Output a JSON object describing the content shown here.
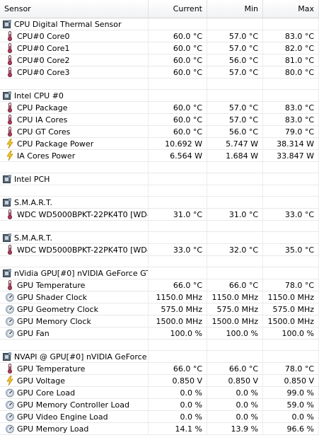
{
  "header": {
    "sensor": "Sensor",
    "current": "Current",
    "min": "Min",
    "max": "Max"
  },
  "rows": [
    {
      "kind": "group",
      "icon": "chip-icon",
      "label": "CPU Digital Thermal Sensor"
    },
    {
      "kind": "item",
      "icon": "thermometer-icon",
      "label": "CPU#0 Core0",
      "cur": "60.0 °C",
      "min": "57.0 °C",
      "max": "83.0 °C"
    },
    {
      "kind": "item",
      "icon": "thermometer-icon",
      "label": "CPU#0 Core1",
      "cur": "60.0 °C",
      "min": "57.0 °C",
      "max": "82.0 °C"
    },
    {
      "kind": "item",
      "icon": "thermometer-icon",
      "label": "CPU#0 Core2",
      "cur": "60.0 °C",
      "min": "56.0 °C",
      "max": "81.0 °C"
    },
    {
      "kind": "item",
      "icon": "thermometer-icon",
      "label": "CPU#0 Core3",
      "cur": "60.0 °C",
      "min": "57.0 °C",
      "max": "80.0 °C"
    },
    {
      "kind": "blank"
    },
    {
      "kind": "group",
      "icon": "chip-icon",
      "label": "Intel CPU #0"
    },
    {
      "kind": "item",
      "icon": "thermometer-icon",
      "label": "CPU Package",
      "cur": "60.0 °C",
      "min": "57.0 °C",
      "max": "83.0 °C"
    },
    {
      "kind": "item",
      "icon": "thermometer-icon",
      "label": "CPU IA Cores",
      "cur": "60.0 °C",
      "min": "57.0 °C",
      "max": "83.0 °C"
    },
    {
      "kind": "item",
      "icon": "thermometer-icon",
      "label": "CPU GT Cores",
      "cur": "60.0 °C",
      "min": "56.0 °C",
      "max": "79.0 °C"
    },
    {
      "kind": "item",
      "icon": "lightning-icon",
      "label": "CPU Package Power",
      "cur": "10.692 W",
      "min": "5.747 W",
      "max": "38.314 W"
    },
    {
      "kind": "item",
      "icon": "lightning-icon",
      "label": "IA Cores Power",
      "cur": "6.564 W",
      "min": "1.684 W",
      "max": "33.847 W"
    },
    {
      "kind": "blank"
    },
    {
      "kind": "group",
      "icon": "chip-icon",
      "label": "Intel PCH"
    },
    {
      "kind": "blank"
    },
    {
      "kind": "group",
      "icon": "chip-icon",
      "label": "S.M.A.R.T."
    },
    {
      "kind": "item",
      "icon": "thermometer-icon",
      "label": "WDC WD5000BPKT-22PK4T0 [WD-...",
      "cur": "31.0 °C",
      "min": "31.0 °C",
      "max": "33.0 °C"
    },
    {
      "kind": "blank"
    },
    {
      "kind": "group",
      "icon": "chip-icon",
      "label": "S.M.A.R.T."
    },
    {
      "kind": "item",
      "icon": "thermometer-icon",
      "label": "WDC WD5000BPKT-22PK4T0 [WD-...",
      "cur": "33.0 °C",
      "min": "32.0 °C",
      "max": "35.0 °C"
    },
    {
      "kind": "blank"
    },
    {
      "kind": "group",
      "icon": "chip-icon",
      "label": "nVidia GPU[#0] nVIDIA GeForce GT..."
    },
    {
      "kind": "item",
      "icon": "thermometer-icon",
      "label": "GPU Temperature",
      "cur": "66.0 °C",
      "min": "66.0 °C",
      "max": "78.0 °C"
    },
    {
      "kind": "item",
      "icon": "gauge-icon",
      "label": "GPU Shader Clock",
      "cur": "1150.0 MHz",
      "min": "1150.0 MHz",
      "max": "1150.0 MHz"
    },
    {
      "kind": "item",
      "icon": "gauge-icon",
      "label": "GPU Geometry Clock",
      "cur": "575.0 MHz",
      "min": "575.0 MHz",
      "max": "575.0 MHz"
    },
    {
      "kind": "item",
      "icon": "gauge-icon",
      "label": "GPU Memory Clock",
      "cur": "1500.0 MHz",
      "min": "1500.0 MHz",
      "max": "1500.0 MHz"
    },
    {
      "kind": "item",
      "icon": "gauge-icon",
      "label": "GPU Fan",
      "cur": "100.0 %",
      "min": "100.0 %",
      "max": "100.0 %"
    },
    {
      "kind": "blank"
    },
    {
      "kind": "group",
      "icon": "chip-icon",
      "label": "NVAPI @ GPU[#0] nVIDIA GeForce ..."
    },
    {
      "kind": "item",
      "icon": "thermometer-icon",
      "label": "GPU Temperature",
      "cur": "66.0 °C",
      "min": "66.0 °C",
      "max": "78.0 °C"
    },
    {
      "kind": "item",
      "icon": "lightning-icon",
      "label": "GPU Voltage",
      "cur": "0.850 V",
      "min": "0.850 V",
      "max": "0.850 V"
    },
    {
      "kind": "item",
      "icon": "gauge-icon",
      "label": "GPU Core Load",
      "cur": "0.0 %",
      "min": "0.0 %",
      "max": "99.0 %"
    },
    {
      "kind": "item",
      "icon": "gauge-icon",
      "label": "GPU Memory Controller Load",
      "cur": "0.0 %",
      "min": "0.0 %",
      "max": "59.0 %"
    },
    {
      "kind": "item",
      "icon": "gauge-icon",
      "label": "GPU Video Engine Load",
      "cur": "0.0 %",
      "min": "0.0 %",
      "max": "0.0 %"
    },
    {
      "kind": "item",
      "icon": "gauge-icon",
      "label": "GPU Memory Load",
      "cur": "14.1 %",
      "min": "13.9 %",
      "max": "96.6 %"
    }
  ]
}
